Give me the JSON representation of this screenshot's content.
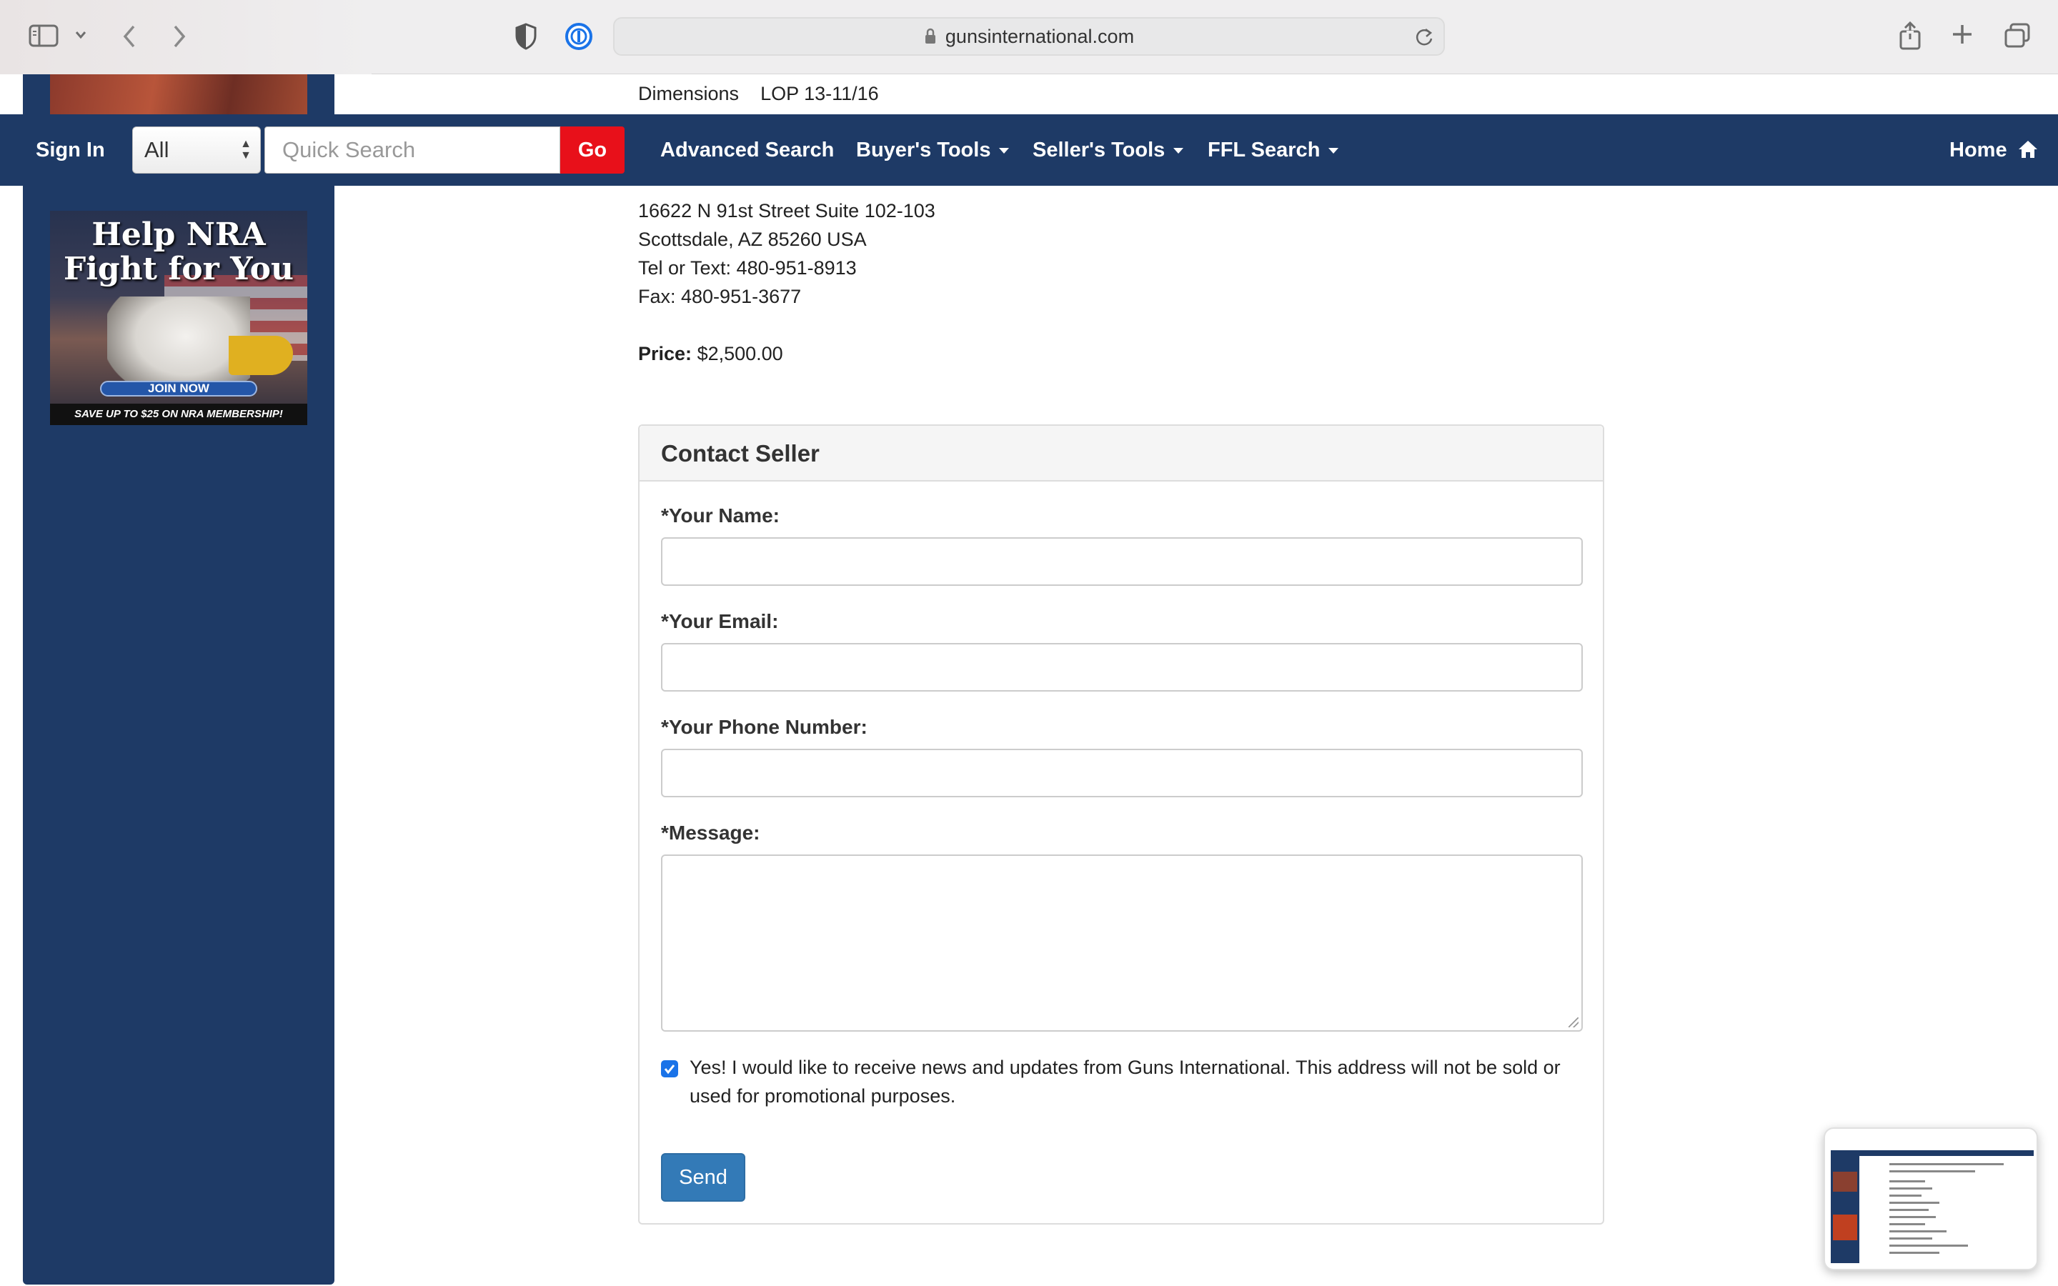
{
  "browser": {
    "url": "gunsinternational.com"
  },
  "listing_partial": {
    "dimensions_label": "Dimensions",
    "dimensions_value": "LOP 13-11/16"
  },
  "nav": {
    "sign_in": "Sign In",
    "category_selected": "All",
    "search_placeholder": "Quick Search",
    "go": "Go",
    "links": {
      "advanced_search": "Advanced Search",
      "buyers_tools": "Buyer's Tools",
      "sellers_tools": "Seller's Tools",
      "ffl_search": "FFL Search",
      "home": "Home"
    }
  },
  "ad": {
    "headline_line1": "Help NRA",
    "headline_line2": "Fight for You",
    "button": "JOIN NOW",
    "footer": "SAVE UP TO $25 ON NRA MEMBERSHIP!"
  },
  "seller": {
    "address_line": "16622 N 91st Street Suite 102-103",
    "city_line": "Scottsdale, AZ 85260 USA",
    "phone_line": "Tel or Text: 480-951-8913",
    "fax_line": "Fax: 480-951-3677",
    "price_label": "Price:",
    "price_value": "$2,500.00"
  },
  "contact_form": {
    "title": "Contact Seller",
    "name_label": "*Your Name:",
    "email_label": "*Your Email:",
    "phone_label": "*Your Phone Number:",
    "message_label": "*Message:",
    "name_value": "",
    "email_value": "",
    "phone_value": "",
    "message_value": "",
    "newsletter_checked": true,
    "newsletter_text": "Yes! I would like to receive news and updates from Guns International. This address will not be sold or used for promotional purposes.",
    "send": "Send"
  },
  "colors": {
    "navy": "#1e3a66",
    "go_red": "#e8101a",
    "send_blue": "#337ab7"
  }
}
